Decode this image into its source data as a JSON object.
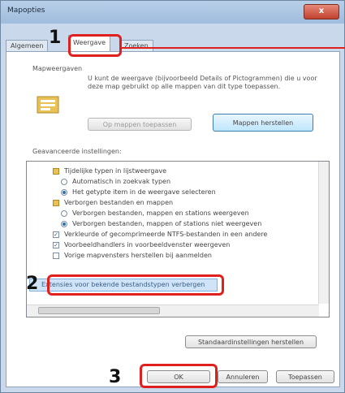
{
  "window": {
    "title": "Mapopties",
    "close_glyph": "x"
  },
  "tabs": [
    "Algemeen",
    "Weergave",
    "Zoeken"
  ],
  "folder_views": {
    "header": "Mapweergaven",
    "description": "U kunt de weergave (bijvoorbeeld Details of Pictogrammen) die u voor deze map gebruikt op alle mappen van dit type toepassen.",
    "apply_button": "Op mappen toepassen",
    "reset_button": "Mappen herstellen"
  },
  "advanced": {
    "header": "Geavanceerde instellingen:",
    "items": [
      {
        "icon": "folder",
        "label": "Tijdelijke typen in lijstweergave"
      },
      {
        "icon": "radio-off",
        "label": "Automatisch in zoekvak typen"
      },
      {
        "icon": "radio-on",
        "label": "Het getypte item in de weergave selecteren"
      },
      {
        "icon": "folder",
        "label": "Verborgen bestanden en mappen"
      },
      {
        "icon": "radio-off",
        "label": "Verborgen bestanden, mappen en stations weergeven"
      },
      {
        "icon": "radio-on",
        "label": "Verborgen bestanden, mappen of stations niet weergeven"
      },
      {
        "icon": "check",
        "label": "Verkleurde of gecomprimeerde NTFS-bestanden in een andere"
      },
      {
        "icon": "check",
        "label": "Voorbeeldhandlers in voorbeeldvenster weergeven"
      },
      {
        "icon": "check",
        "label": "Vorige mapvensters herstellen bij aanmelden"
      }
    ],
    "selected_item": "Extensies voor bekende bestandstypen verbergen",
    "defaults_button": "Standaardinstellingen herstellen"
  },
  "buttons": {
    "ok": "OK",
    "cancel": "Annuleren",
    "apply": "Toepassen"
  },
  "callouts": {
    "one": "1",
    "two": "2",
    "three": "3"
  },
  "colors": {
    "highlight": "#e0201f",
    "selection": "#cfe4f8"
  }
}
